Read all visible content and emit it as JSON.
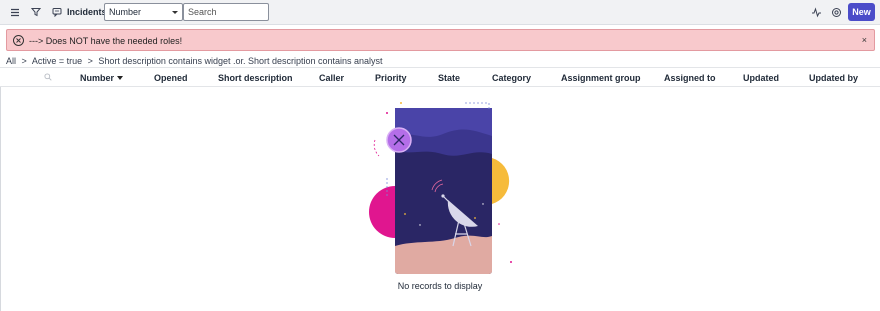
{
  "toolbar": {
    "title": "Incidents",
    "field_select": "Number",
    "search_placeholder": "Search",
    "new_label": "New"
  },
  "alert": {
    "message": "---> Does NOT have the needed roles!",
    "close": "×"
  },
  "breadcrumb": [
    "All",
    ">",
    "Active = true",
    ">",
    "Short description contains widget .or. Short description contains analyst"
  ],
  "columns": [
    "Number",
    "Opened",
    "Short description",
    "Caller",
    "Priority",
    "State",
    "Category",
    "Assignment group",
    "Assigned to",
    "Updated",
    "Updated by"
  ],
  "empty_state": {
    "caption": "No records to display"
  },
  "colors": {
    "accent": "#4b4cc9",
    "alert_bg": "#f8c9cc",
    "illus_bg": "#2d2a6e"
  }
}
